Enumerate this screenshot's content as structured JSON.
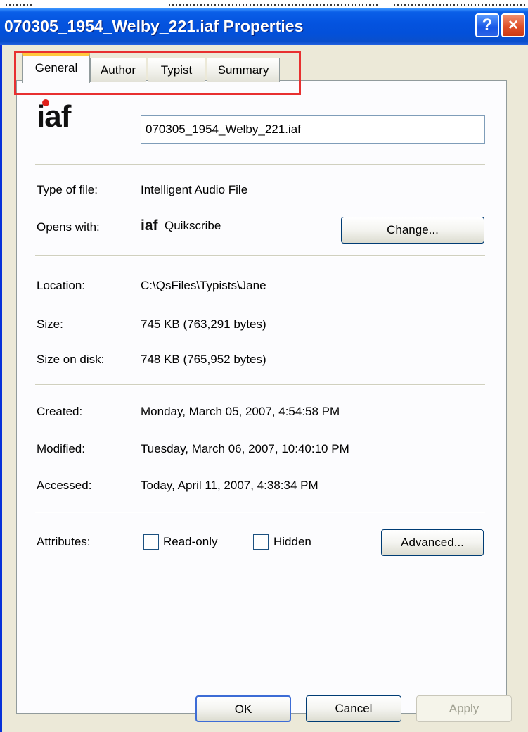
{
  "window": {
    "title": "070305_1954_Welby_221.iaf Properties",
    "help_glyph": "?",
    "close_glyph": "×"
  },
  "tabs": [
    {
      "label": "General",
      "active": true
    },
    {
      "label": "Author",
      "active": false
    },
    {
      "label": "Typist",
      "active": false
    },
    {
      "label": "Summary",
      "active": false
    }
  ],
  "general": {
    "icon_text": "iaf",
    "filename": "070305_1954_Welby_221.iaf",
    "type_label": "Type of file:",
    "type_value": "Intelligent Audio File",
    "opens_label": "Opens with:",
    "opens_icon_text": "iaf",
    "opens_value": "Quikscribe",
    "change_button": "Change...",
    "location_label": "Location:",
    "location_value": "C:\\QsFiles\\Typists\\Jane",
    "size_label": "Size:",
    "size_value": "745 KB (763,291 bytes)",
    "size_on_disk_label": "Size on disk:",
    "size_on_disk_value": "748 KB (765,952 bytes)",
    "created_label": "Created:",
    "created_value": "Monday, March 05, 2007, 4:54:58 PM",
    "modified_label": "Modified:",
    "modified_value": "Tuesday, March 06, 2007, 10:40:10 PM",
    "accessed_label": "Accessed:",
    "accessed_value": "Today, April 11, 2007, 4:38:34 PM",
    "attributes_label": "Attributes:",
    "readonly_label": "Read-only",
    "hidden_label": "Hidden",
    "readonly_checked": false,
    "hidden_checked": false,
    "advanced_button": "Advanced..."
  },
  "buttons": {
    "ok": "OK",
    "cancel": "Cancel",
    "apply": "Apply"
  },
  "colors": {
    "titlebar": "#0453df",
    "highlight": "#e83030",
    "active_tab_accent": "#ffc83c"
  }
}
